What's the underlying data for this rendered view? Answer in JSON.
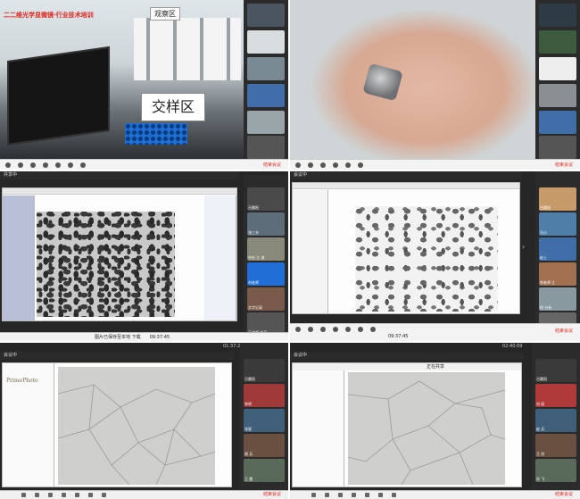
{
  "panel1": {
    "banner": "二二维光学显微镜·行业技术培训",
    "tag_observe": "观察区",
    "tag_sample": "交样区",
    "end_label": "结束会议"
  },
  "panel2": {
    "end_label": "结束会议"
  },
  "panel3": {
    "title": "共享中",
    "bottom_text": "图片已保存至本地 下载",
    "time": "09:37:45",
    "participants": [
      "吕晨阳",
      "张三丰",
      "中台 江 流",
      "刘老师",
      "文字记录",
      "王老师 共享"
    ]
  },
  "panel4": {
    "title": "会议中",
    "end_label": "结束会议",
    "time": "09:37:45",
    "participants": [
      "吕晨阳",
      "马小",
      "赵上",
      "李老师 江",
      "徐 分析",
      "赵老师"
    ]
  },
  "panel5": {
    "title": "会议中",
    "time": "01:37:22",
    "brand": "PrimePhoto",
    "participants": [
      "吕晨阳",
      "李明",
      "张星",
      "周 兵",
      "王 霞"
    ],
    "end_label": "结束会议"
  },
  "panel6": {
    "title": "会议中",
    "header": "正在共享",
    "time": "02:40:09",
    "participants": [
      "吕晨阳",
      "刘 丽",
      "赵 兵",
      "王 欣",
      "孙 飞"
    ],
    "end_label": "结束会议"
  }
}
